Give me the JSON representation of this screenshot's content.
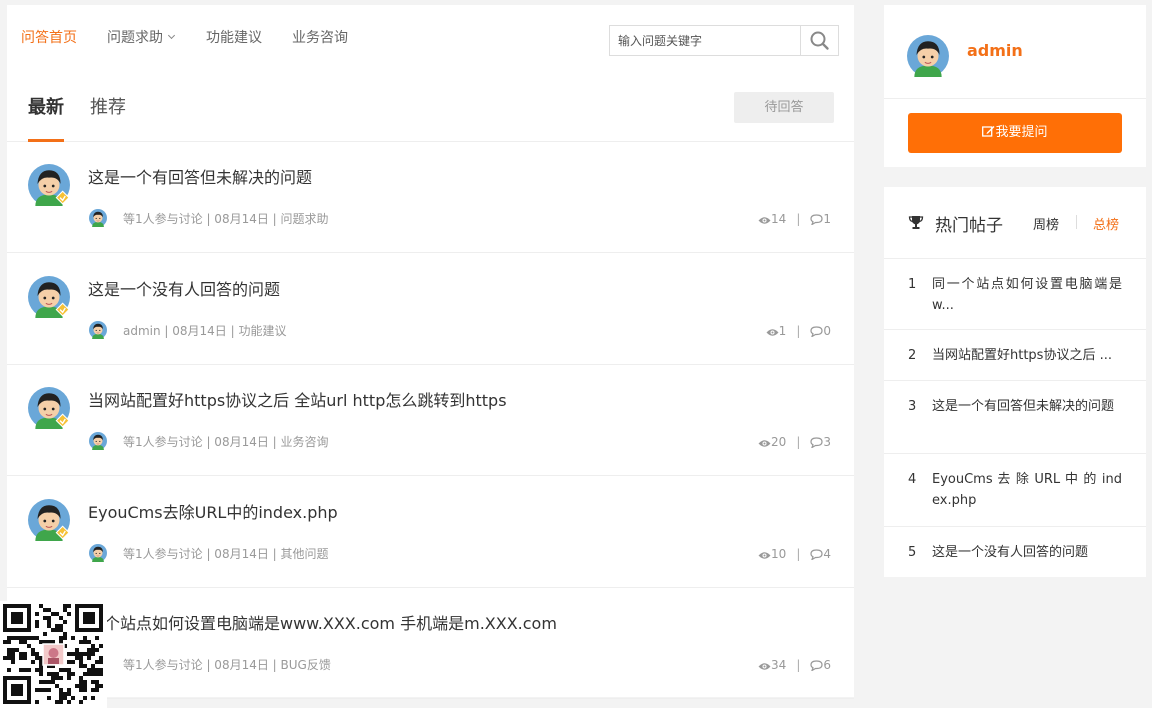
{
  "nav": {
    "items": [
      {
        "label": "问答首页",
        "active": true
      },
      {
        "label": "问题求助",
        "has_dropdown": true
      },
      {
        "label": "功能建议"
      },
      {
        "label": "业务咨询"
      }
    ],
    "search_placeholder": "输入问题关键字"
  },
  "tabs": {
    "latest": "最新",
    "recommended": "推荐",
    "pending_button": "待回答"
  },
  "questions": [
    {
      "title": "这是一个有回答但未解决的问题",
      "meta": "等1人参与讨论 | 08月14日 | 问题求助",
      "views": "14",
      "replies": "1"
    },
    {
      "title": "这是一个没有人回答的问题",
      "meta": "admin | 08月14日 | 功能建议",
      "views": "1",
      "replies": "0"
    },
    {
      "title": "当网站配置好https协议之后 全站url http怎么跳转到https",
      "meta": "等1人参与讨论 | 08月14日 | 业务咨询",
      "views": "20",
      "replies": "3"
    },
    {
      "title": "EyouCms去除URL中的index.php",
      "meta": "等1人参与讨论 | 08月14日 | 其他问题",
      "views": "10",
      "replies": "4"
    },
    {
      "title": "一个站点如何设置电脑端是www.XXX.com 手机端是m.XXX.com",
      "meta": "等1人参与讨论 | 08月14日 | BUG反馈",
      "views": "34",
      "replies": "6"
    }
  ],
  "user": {
    "name": "admin",
    "ask_button": "我要提问"
  },
  "hot": {
    "title": "热门帖子",
    "weekly": "周榜",
    "total": "总榜",
    "items": [
      {
        "rank": "1",
        "text": "同一个站点如何设置电脑端是w..."
      },
      {
        "rank": "2",
        "text": "当网站配置好https协议之后 ..."
      },
      {
        "rank": "3",
        "text": "这是一个有回答但未解决的问题"
      },
      {
        "rank": "4",
        "text": "EyouCms 去 除 URL 中 的 index.php"
      },
      {
        "rank": "5",
        "text": "这是一个没有人回答的问题"
      }
    ]
  },
  "colors": {
    "accent": "#f37018",
    "button": "#ff6f06"
  },
  "icons": [
    "search-icon",
    "eye-icon",
    "comment-icon",
    "trophy-icon",
    "edit-icon",
    "chevron-down-icon",
    "qr-code"
  ]
}
